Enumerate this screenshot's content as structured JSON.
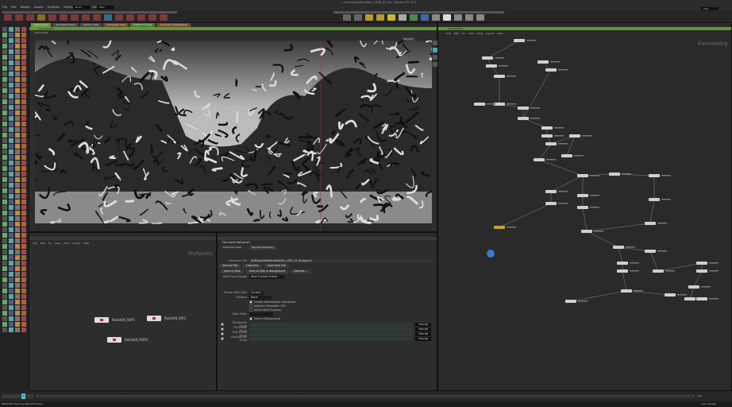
{
  "window": {
    "title": "...Landscape/Mountain_v006_01.hip - Houdini FX 19.0"
  },
  "menu": [
    "File",
    "Edit",
    "Render",
    "Assets",
    "Windows",
    "Solaris",
    "Redshift",
    "Help"
  ],
  "desktop": {
    "build": "Build",
    "main": "Main",
    "right": "Main"
  },
  "viewport": {
    "tab": "Scene View",
    "obj": "obj",
    "net": "Redfalls",
    "camera": "No cam"
  },
  "network_left": {
    "tabs": [
      "Scene View",
      "Animation Editor",
      "Render View",
      "Composite View",
      "Motion FX View",
      "Geometry Spreadsheet"
    ],
    "label": "Outputs",
    "menu": [
      "Add",
      "Edit",
      "Go",
      "View",
      "Tools",
      "Layout",
      "Help"
    ],
    "nodes": [
      "Redshift_ROP1",
      "Redshift_IPR1",
      "Redshift_ROP2"
    ]
  },
  "params": {
    "header": "File Cache  fileCache1",
    "tabs": [
      "Load from Disk",
      "Recook Geometry"
    ],
    "geometry_file_label": "Geometry File",
    "geometry_file": "$HIP/geo/Redfalls/Redfalls_v007_01.$F.bgeo.sc",
    "subtabs": [
      "Save to File",
      "Load Geo",
      "Load from File"
    ],
    "buttons": [
      "Save to Disk",
      "Save to Disk in Background",
      "Controls..."
    ],
    "valid_range_label": "Valid Frame Range",
    "valid_range": "Save Current Frame",
    "take_label": "Render With Take",
    "take": "Current",
    "init_label": "Initialize",
    "init": "None",
    "checks": [
      "Create Intermediate Directories",
      "Initialize Simulation OPs",
      "Alfred Style Progress"
    ],
    "alert_label": "Alert Prefix",
    "save_bg": "Save in Background",
    "scripts": [
      "Pre-Render Script",
      "Pre-Frame Script",
      "Post-Frame Script",
      "Post-Render Script"
    ],
    "script_lang": "Hscript"
  },
  "network_right": {
    "label": "Geometry",
    "menu": [
      "Add",
      "Edit",
      "Go",
      "View",
      "Tools",
      "Layout",
      "Help"
    ]
  },
  "timeline": {
    "frame": "1",
    "end": "240"
  },
  "status": {
    "text": "REDSHIFT: Building Redshift Scene",
    "right": "Auto Update"
  }
}
